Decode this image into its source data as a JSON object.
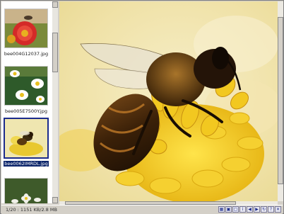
{
  "thumbnails": [
    {
      "filename": "bee004G12037.jpg",
      "selected": false
    },
    {
      "filename": "bee005E7500Y.jpg",
      "selected": false
    },
    {
      "filename": "bee0062IMRDL.jpg",
      "selected": true
    },
    {
      "filename": "",
      "selected": false
    }
  ],
  "status": {
    "text": "1/20 : 1151 KB/2.8 MB"
  },
  "toolbar": {
    "buttons": [
      {
        "name": "grid-view-icon",
        "glyph": "▦"
      },
      {
        "name": "image-icon",
        "glyph": "▣"
      },
      {
        "name": "fullscreen-icon",
        "glyph": "▢"
      },
      {
        "name": "info-icon",
        "glyph": "i"
      },
      {
        "name": "previous-icon",
        "glyph": "◀"
      },
      {
        "name": "next-icon",
        "glyph": "▶"
      },
      {
        "name": "rotate-icon",
        "glyph": "↻"
      },
      {
        "name": "help-icon",
        "glyph": "?"
      },
      {
        "name": "close-icon",
        "glyph": "✕"
      }
    ]
  },
  "colors": {
    "selection": "#0a246a",
    "thumb_border_selected": "#1c2c8c",
    "panel_bg": "#ffffff",
    "chrome": "#d4d0c8"
  }
}
